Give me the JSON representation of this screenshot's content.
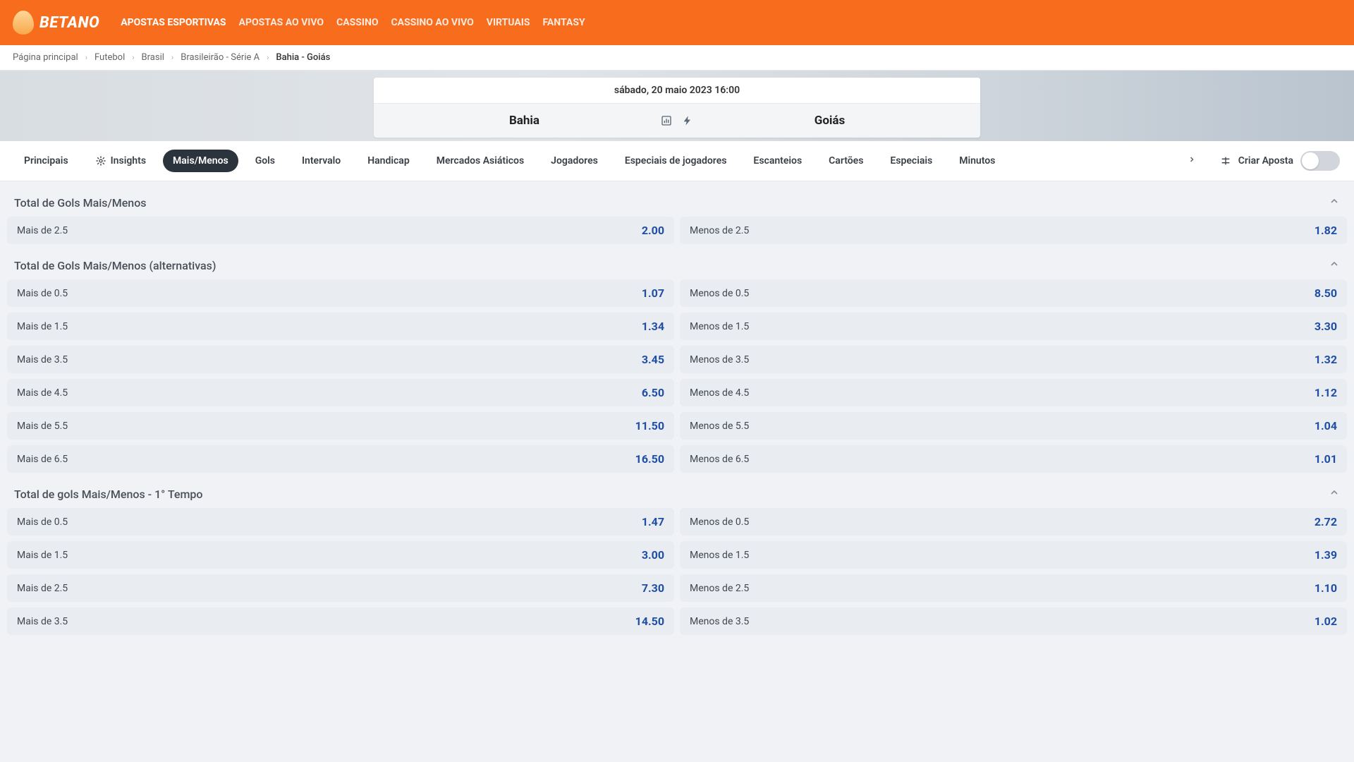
{
  "header": {
    "brand": "BETANO",
    "nav": [
      "APOSTAS ESPORTIVAS",
      "APOSTAS AO VIVO",
      "CASSINO",
      "CASSINO AO VIVO",
      "VIRTUAIS",
      "FANTASY"
    ]
  },
  "breadcrumb": {
    "items": [
      "Página principal",
      "Futebol",
      "Brasil",
      "Brasileirão - Série A"
    ],
    "current": "Bahia - Goiás"
  },
  "match": {
    "date": "sábado, 20 maio 2023 16:00",
    "home": "Bahia",
    "away": "Goiás"
  },
  "tabs": {
    "items": [
      "Principais",
      "Insights",
      "Mais/Menos",
      "Gols",
      "Intervalo",
      "Handicap",
      "Mercados Asiáticos",
      "Jogadores",
      "Especiais de jogadores",
      "Escanteios",
      "Cartões",
      "Especiais",
      "Minutos"
    ],
    "active_index": 2,
    "criar_label": "Criar Aposta"
  },
  "markets": [
    {
      "title": "Total de Gols Mais/Menos",
      "rows": [
        {
          "left_label": "Mais de 2.5",
          "left_odd": "2.00",
          "right_label": "Menos de 2.5",
          "right_odd": "1.82"
        }
      ]
    },
    {
      "title": "Total de Gols Mais/Menos (alternativas)",
      "rows": [
        {
          "left_label": "Mais de 0.5",
          "left_odd": "1.07",
          "right_label": "Menos de 0.5",
          "right_odd": "8.50"
        },
        {
          "left_label": "Mais de 1.5",
          "left_odd": "1.34",
          "right_label": "Menos de 1.5",
          "right_odd": "3.30"
        },
        {
          "left_label": "Mais de 3.5",
          "left_odd": "3.45",
          "right_label": "Menos de 3.5",
          "right_odd": "1.32"
        },
        {
          "left_label": "Mais de 4.5",
          "left_odd": "6.50",
          "right_label": "Menos de 4.5",
          "right_odd": "1.12"
        },
        {
          "left_label": "Mais de 5.5",
          "left_odd": "11.50",
          "right_label": "Menos de 5.5",
          "right_odd": "1.04"
        },
        {
          "left_label": "Mais de 6.5",
          "left_odd": "16.50",
          "right_label": "Menos de 6.5",
          "right_odd": "1.01"
        }
      ]
    },
    {
      "title": "Total de gols Mais/Menos - 1° Tempo",
      "rows": [
        {
          "left_label": "Mais de 0.5",
          "left_odd": "1.47",
          "right_label": "Menos de 0.5",
          "right_odd": "2.72"
        },
        {
          "left_label": "Mais de 1.5",
          "left_odd": "3.00",
          "right_label": "Menos de 1.5",
          "right_odd": "1.39"
        },
        {
          "left_label": "Mais de 2.5",
          "left_odd": "7.30",
          "right_label": "Menos de 2.5",
          "right_odd": "1.10"
        },
        {
          "left_label": "Mais de 3.5",
          "left_odd": "14.50",
          "right_label": "Menos de 3.5",
          "right_odd": "1.02"
        }
      ]
    }
  ]
}
